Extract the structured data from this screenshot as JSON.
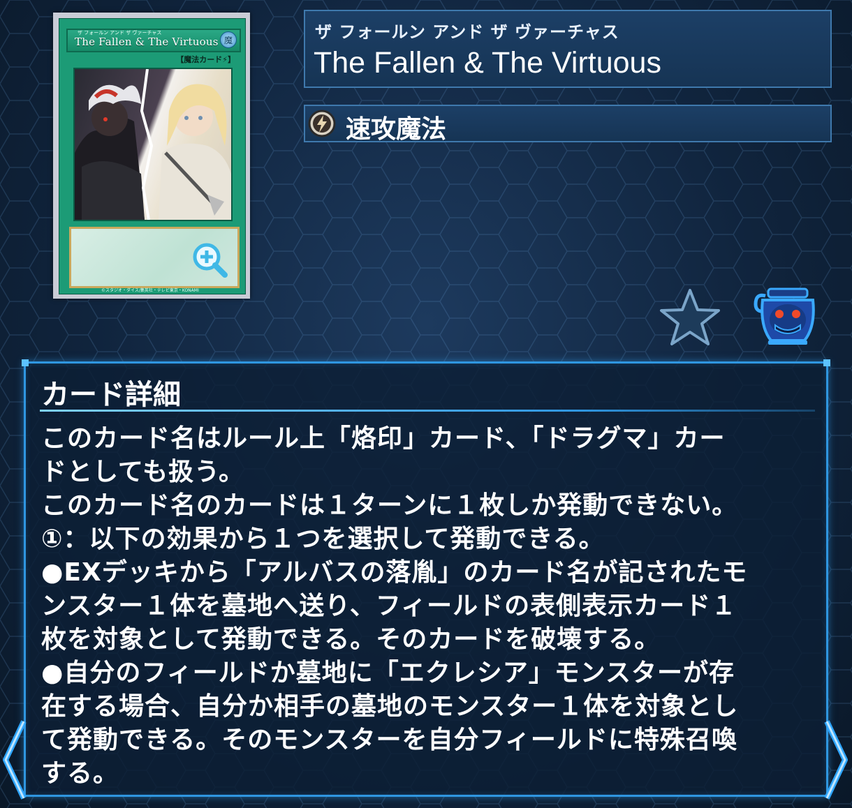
{
  "card_image": {
    "furigana": "ザ  フォールン  アンド  ザ  ヴァーチャス",
    "name": "The Fallen & The Virtuous",
    "attribute_glyph": "魔",
    "type_line": "【魔法カード⚡】",
    "copyright": "©スタジオ・ダイス/集英社・テレビ東京・KONAMI"
  },
  "header": {
    "name_ruby": "ザ フォールン アンド ザ ヴァーチャス",
    "name": "The Fallen & The Virtuous",
    "type": "速攻魔法"
  },
  "icons": {
    "spell": "quick-play-spell-icon",
    "star": "star-icon",
    "pot": "pot-of-greed-icon",
    "zoom": "zoom-in-icon",
    "prev": "chevron-left-icon",
    "next": "chevron-right-icon"
  },
  "colors": {
    "accent": "#2f96e0",
    "card_green": "#1c9b76",
    "panel": "#163454"
  },
  "detail": {
    "title": "カード詳細",
    "lines": [
      "このカード名はルール上「烙印」カード、「ドラグマ」カー",
      "ドとしても扱う。",
      "このカード名のカードは１ターンに１枚しか発動できない。",
      "①：以下の効果から１つを選択して発動できる。",
      "●EXデッキから「アルバスの落胤」のカード名が記されたモ",
      "ンスター１体を墓地へ送り、フィールドの表側表示カード１",
      "枚を対象として発動できる。そのカードを破壊する。",
      "●自分のフィールドか墓地に「エクレシア」モンスターが存",
      "在する場合、自分か相手の墓地のモンスター１体を対象とし",
      "て発動できる。そのモンスターを自分フィールドに特殊召喚",
      "する。"
    ]
  }
}
